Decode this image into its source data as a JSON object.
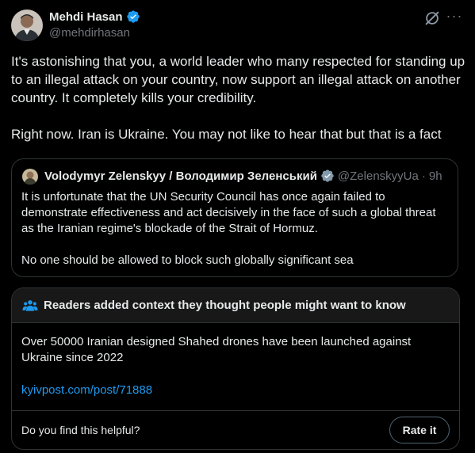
{
  "author": {
    "name": "Mehdi Hasan",
    "handle": "@mehdirhasan",
    "avatar_icon": "person-avatar",
    "verified_color": "#1d9bf0"
  },
  "actions": {
    "grok_icon": "grok-icon",
    "more_glyph": "···"
  },
  "tweet": {
    "paragraph1": "It's astonishing that you, a world leader who many respected for standing up to an illegal attack on your country, now support an illegal attack on another country. It completely kills your credibility.",
    "paragraph2": "Right now. Iran is Ukraine. You may not like to hear that but that is a fact"
  },
  "quote": {
    "name": "Volodymyr Zelenskyy / Володимир Зеленський",
    "handle": "@ZelenskyyUa",
    "separator": "·",
    "time": "9h",
    "paragraph1": "It is unfortunate that the UN Security Council has once again failed to demonstrate effectiveness and act decisively in the face of such a global threat as the Iranian regime's blockade of the Strait of Hormuz.",
    "paragraph2": "No one should be allowed to block such globally significant sea"
  },
  "community_note": {
    "title": "Readers added context they thought people might want to know",
    "body": "Over 50000 Iranian designed Shahed drones have been launched against Ukraine since 2022",
    "link": "kyivpost.com/post/71888",
    "question": "Do you find this helpful?",
    "rate_label": "Rate it",
    "icon": "people-icon",
    "icon_color": "#1d9bf0"
  },
  "colors": {
    "background": "#000000",
    "text": "#e7e9ea",
    "muted": "#71767b",
    "border": "#2f3336",
    "link": "#1d9bf0"
  }
}
